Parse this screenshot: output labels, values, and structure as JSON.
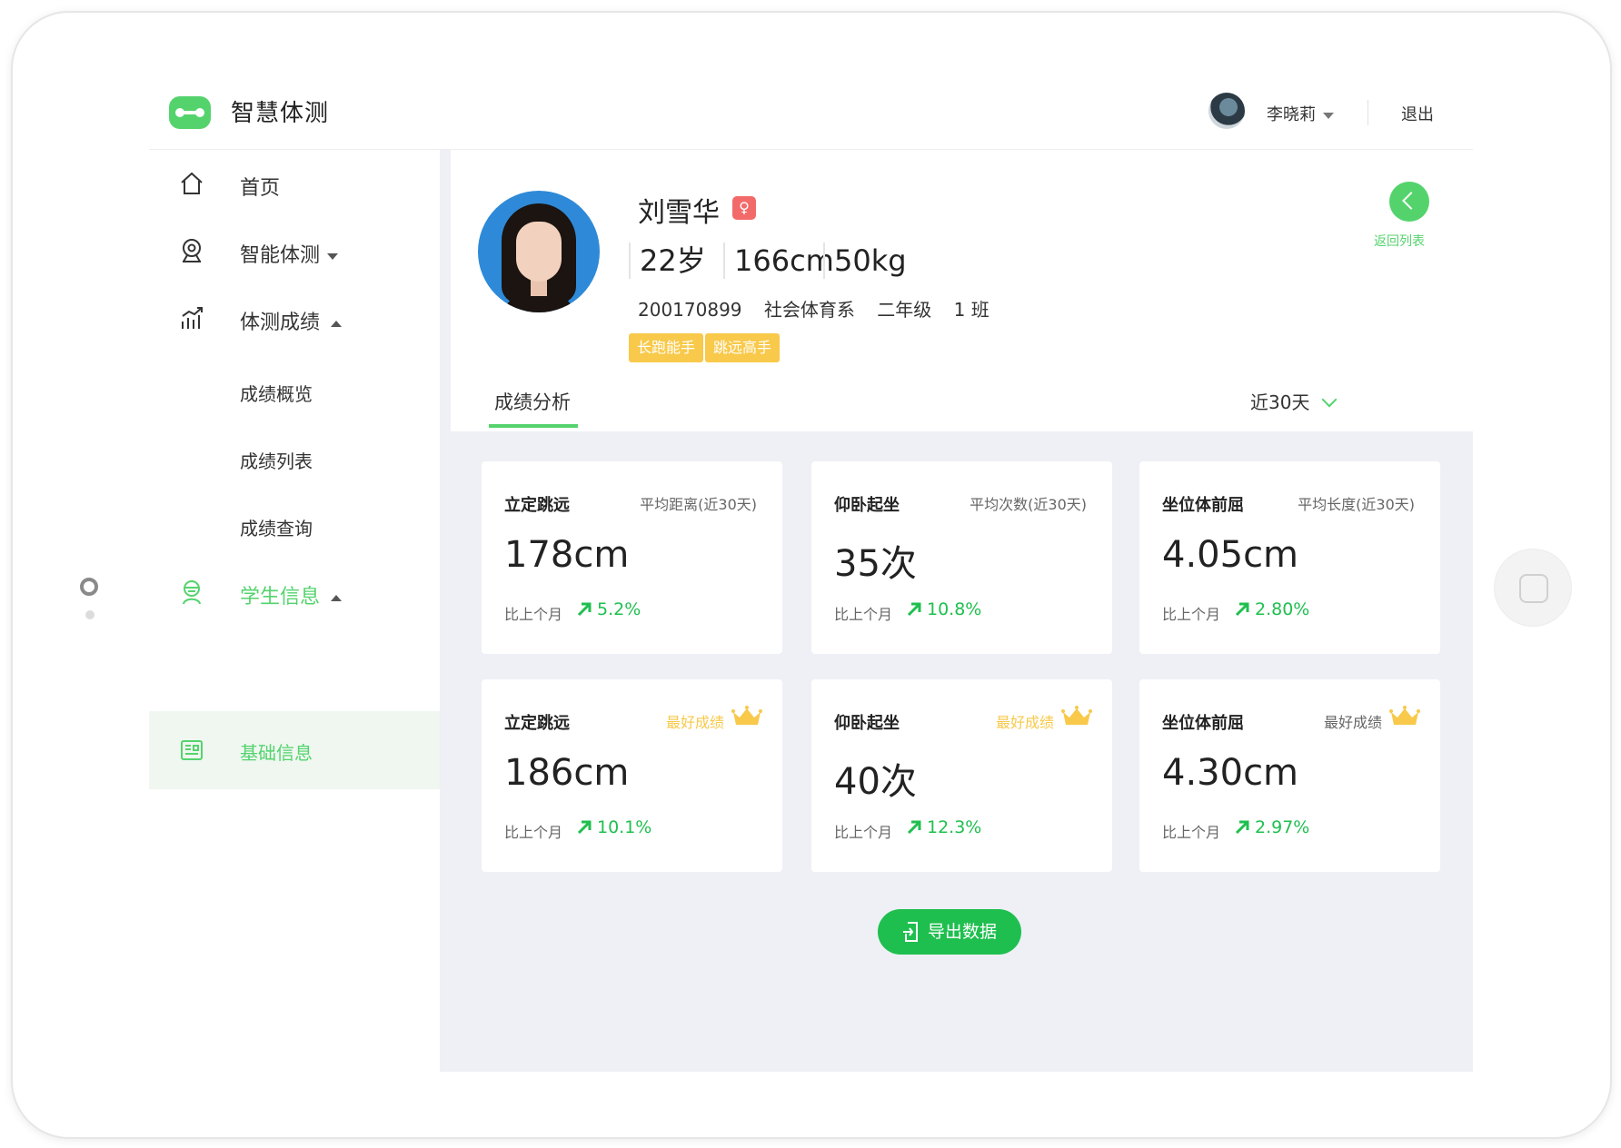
{
  "app": {
    "title": "智慧体测"
  },
  "header": {
    "user_name": "李晓莉",
    "logout": "退出"
  },
  "sidebar": {
    "items": [
      {
        "label": "首页",
        "icon": "home-icon"
      },
      {
        "label": "智能体测",
        "icon": "camera-icon"
      },
      {
        "label": "体测成绩",
        "icon": "chart-icon"
      },
      {
        "label": "成绩概览"
      },
      {
        "label": "成绩列表"
      },
      {
        "label": "成绩查询"
      },
      {
        "label": "学生信息",
        "icon": "student-icon"
      },
      {
        "label": "基础信息",
        "icon": "document-icon"
      }
    ]
  },
  "profile": {
    "name": "刘雪华",
    "gender_symbol": "♀",
    "age": "22岁",
    "height": "166cm",
    "weight": "50kg",
    "student_id": "200170899",
    "department": "社会体育系",
    "grade": "二年级",
    "class": "1 班",
    "tags": [
      "长跑能手",
      "跳远高手"
    ],
    "back_label": "返回列表"
  },
  "tabs": {
    "analysis": "成绩分析",
    "range": "近30天"
  },
  "cards_avg": [
    {
      "title": "立定跳远",
      "sub": "平均距离(近30天)",
      "value": "178cm",
      "compare_label": "比上个月",
      "change": "5.2%"
    },
    {
      "title": "仰卧起坐",
      "sub": "平均次数(近30天)",
      "value": "35次",
      "compare_label": "比上个月",
      "change": "10.8%"
    },
    {
      "title": "坐位体前屈",
      "sub": "平均长度(近30天)",
      "value": "4.05cm",
      "compare_label": "比上个月",
      "change": "2.80%"
    }
  ],
  "cards_best": [
    {
      "title": "立定跳远",
      "best": "最好成绩",
      "value": "186cm",
      "compare_label": "比上个月",
      "change": "10.1%"
    },
    {
      "title": "仰卧起坐",
      "best": "最好成绩",
      "value": "40次",
      "compare_label": "比上个月",
      "change": "12.3%"
    },
    {
      "title": "坐位体前屈",
      "best": "最好成绩",
      "value": "4.30cm",
      "compare_label": "比上个月",
      "change": "2.97%"
    }
  ],
  "export": {
    "label": "导出数据"
  },
  "colors": {
    "accent": "#54d36d",
    "trend": "#1fbf4f",
    "tag": "#f8c94a",
    "gender": "#f36a6a",
    "main_bg": "#eef0f5"
  }
}
